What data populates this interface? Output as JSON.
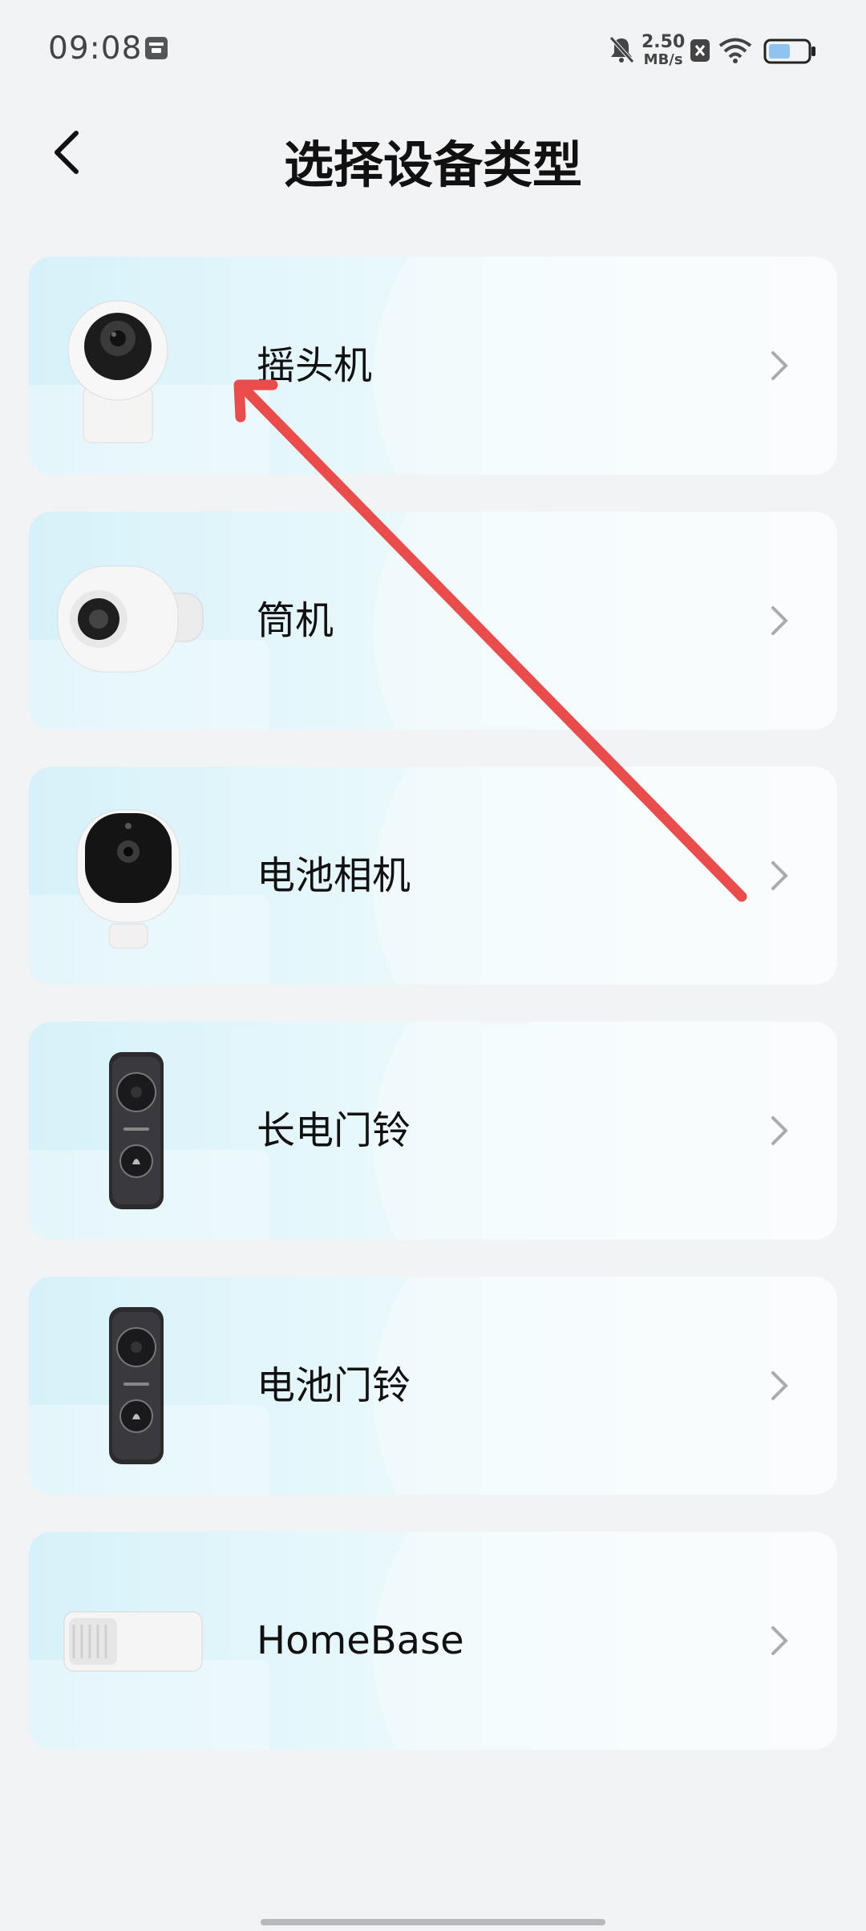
{
  "status_bar": {
    "time": "09:08",
    "net_speed_value": "2.50",
    "net_speed_unit": "MB/s",
    "icons": [
      "notification-icon",
      "mute-icon",
      "x-badge-icon",
      "wifi-icon",
      "battery-icon"
    ]
  },
  "header": {
    "title": "选择设备类型",
    "back_icon": "chevron-left-icon"
  },
  "devices": [
    {
      "label": "摇头机",
      "icon": "ptz-camera-icon"
    },
    {
      "label": "筒机",
      "icon": "bullet-camera-icon"
    },
    {
      "label": "电池相机",
      "icon": "battery-camera-icon"
    },
    {
      "label": "长电门铃",
      "icon": "doorbell-icon"
    },
    {
      "label": "电池门铃",
      "icon": "doorbell-icon"
    },
    {
      "label": "HomeBase",
      "icon": "homebase-icon"
    }
  ],
  "annotation": {
    "type": "arrow",
    "color": "#ea4b4b"
  },
  "colors": {
    "background": "#f2f3f5",
    "card_start": "#d6f1f9",
    "card_end": "#f8fbfc",
    "arrow": "#ea4b4b"
  }
}
